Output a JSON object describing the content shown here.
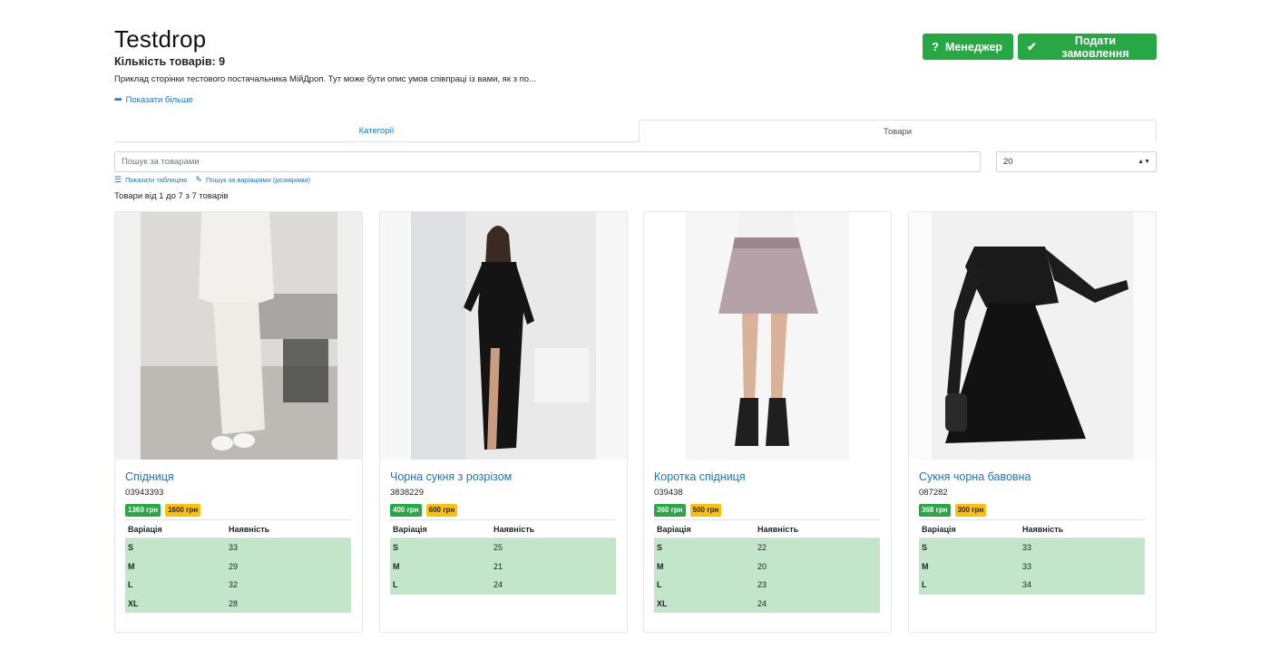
{
  "store": {
    "title": "Testdrop",
    "count_label": "Кількість товарів: 9",
    "description": "Приклад сторінки тестового постачальника МійДроп. Тут може бути опис умов співпраці із вами, як з по...",
    "show_more": "Показати більше"
  },
  "buttons": {
    "manager": "Менеджер",
    "order": "Подати замовлення"
  },
  "tabs": {
    "categories": "Категорії",
    "goods": "Товари"
  },
  "search": {
    "placeholder": "Пошук за товарами",
    "per_page": "20"
  },
  "links": {
    "table_view": "Показати таблицею",
    "variation_search": "Пошук за варіаціями (розмірами)"
  },
  "range_text": "Товари від 1 до 7 з 7 товарів",
  "table_headers": {
    "variation": "Варіація",
    "availability": "Наявність"
  },
  "colors": {
    "accent": "#28a745",
    "link": "#1a73c7",
    "stock_row": "#c3e6cb",
    "price_alt": "#ffc107"
  },
  "products": [
    {
      "title": "Спідниця",
      "sku": "03943393",
      "price_drop": "1369 грн",
      "price_retail": "1600 грн",
      "variations": [
        {
          "size": "S",
          "qty": "33"
        },
        {
          "size": "M",
          "qty": "29"
        },
        {
          "size": "L",
          "qty": "32"
        },
        {
          "size": "XL",
          "qty": "28"
        }
      ]
    },
    {
      "title": "Чорна сукня з розрізом",
      "sku": "3838229",
      "price_drop": "400 грн",
      "price_retail": "600 грн",
      "variations": [
        {
          "size": "S",
          "qty": "25"
        },
        {
          "size": "M",
          "qty": "21"
        },
        {
          "size": "L",
          "qty": "24"
        }
      ]
    },
    {
      "title": "Коротка спідниця",
      "sku": "039438",
      "price_drop": "360 грн",
      "price_retail": "500 грн",
      "variations": [
        {
          "size": "S",
          "qty": "22"
        },
        {
          "size": "M",
          "qty": "20"
        },
        {
          "size": "L",
          "qty": "23"
        },
        {
          "size": "XL",
          "qty": "24"
        }
      ]
    },
    {
      "title": "Сукня чорна бавовна",
      "sku": "087282",
      "price_drop": "368 грн",
      "price_retail": "300 грн",
      "variations": [
        {
          "size": "S",
          "qty": "33"
        },
        {
          "size": "M",
          "qty": "33"
        },
        {
          "size": "L",
          "qty": "34"
        }
      ]
    }
  ]
}
